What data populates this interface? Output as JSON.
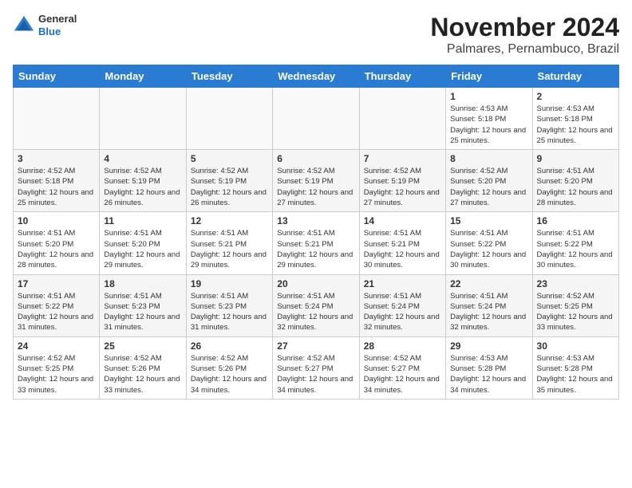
{
  "header": {
    "logo_general": "General",
    "logo_blue": "Blue",
    "month_title": "November 2024",
    "location": "Palmares, Pernambuco, Brazil"
  },
  "days_of_week": [
    "Sunday",
    "Monday",
    "Tuesday",
    "Wednesday",
    "Thursday",
    "Friday",
    "Saturday"
  ],
  "weeks": [
    [
      {
        "day": "",
        "info": ""
      },
      {
        "day": "",
        "info": ""
      },
      {
        "day": "",
        "info": ""
      },
      {
        "day": "",
        "info": ""
      },
      {
        "day": "",
        "info": ""
      },
      {
        "day": "1",
        "info": "Sunrise: 4:53 AM\nSunset: 5:18 PM\nDaylight: 12 hours and 25 minutes."
      },
      {
        "day": "2",
        "info": "Sunrise: 4:53 AM\nSunset: 5:18 PM\nDaylight: 12 hours and 25 minutes."
      }
    ],
    [
      {
        "day": "3",
        "info": "Sunrise: 4:52 AM\nSunset: 5:18 PM\nDaylight: 12 hours and 25 minutes."
      },
      {
        "day": "4",
        "info": "Sunrise: 4:52 AM\nSunset: 5:19 PM\nDaylight: 12 hours and 26 minutes."
      },
      {
        "day": "5",
        "info": "Sunrise: 4:52 AM\nSunset: 5:19 PM\nDaylight: 12 hours and 26 minutes."
      },
      {
        "day": "6",
        "info": "Sunrise: 4:52 AM\nSunset: 5:19 PM\nDaylight: 12 hours and 27 minutes."
      },
      {
        "day": "7",
        "info": "Sunrise: 4:52 AM\nSunset: 5:19 PM\nDaylight: 12 hours and 27 minutes."
      },
      {
        "day": "8",
        "info": "Sunrise: 4:52 AM\nSunset: 5:20 PM\nDaylight: 12 hours and 27 minutes."
      },
      {
        "day": "9",
        "info": "Sunrise: 4:51 AM\nSunset: 5:20 PM\nDaylight: 12 hours and 28 minutes."
      }
    ],
    [
      {
        "day": "10",
        "info": "Sunrise: 4:51 AM\nSunset: 5:20 PM\nDaylight: 12 hours and 28 minutes."
      },
      {
        "day": "11",
        "info": "Sunrise: 4:51 AM\nSunset: 5:20 PM\nDaylight: 12 hours and 29 minutes."
      },
      {
        "day": "12",
        "info": "Sunrise: 4:51 AM\nSunset: 5:21 PM\nDaylight: 12 hours and 29 minutes."
      },
      {
        "day": "13",
        "info": "Sunrise: 4:51 AM\nSunset: 5:21 PM\nDaylight: 12 hours and 29 minutes."
      },
      {
        "day": "14",
        "info": "Sunrise: 4:51 AM\nSunset: 5:21 PM\nDaylight: 12 hours and 30 minutes."
      },
      {
        "day": "15",
        "info": "Sunrise: 4:51 AM\nSunset: 5:22 PM\nDaylight: 12 hours and 30 minutes."
      },
      {
        "day": "16",
        "info": "Sunrise: 4:51 AM\nSunset: 5:22 PM\nDaylight: 12 hours and 30 minutes."
      }
    ],
    [
      {
        "day": "17",
        "info": "Sunrise: 4:51 AM\nSunset: 5:22 PM\nDaylight: 12 hours and 31 minutes."
      },
      {
        "day": "18",
        "info": "Sunrise: 4:51 AM\nSunset: 5:23 PM\nDaylight: 12 hours and 31 minutes."
      },
      {
        "day": "19",
        "info": "Sunrise: 4:51 AM\nSunset: 5:23 PM\nDaylight: 12 hours and 31 minutes."
      },
      {
        "day": "20",
        "info": "Sunrise: 4:51 AM\nSunset: 5:24 PM\nDaylight: 12 hours and 32 minutes."
      },
      {
        "day": "21",
        "info": "Sunrise: 4:51 AM\nSunset: 5:24 PM\nDaylight: 12 hours and 32 minutes."
      },
      {
        "day": "22",
        "info": "Sunrise: 4:51 AM\nSunset: 5:24 PM\nDaylight: 12 hours and 32 minutes."
      },
      {
        "day": "23",
        "info": "Sunrise: 4:52 AM\nSunset: 5:25 PM\nDaylight: 12 hours and 33 minutes."
      }
    ],
    [
      {
        "day": "24",
        "info": "Sunrise: 4:52 AM\nSunset: 5:25 PM\nDaylight: 12 hours and 33 minutes."
      },
      {
        "day": "25",
        "info": "Sunrise: 4:52 AM\nSunset: 5:26 PM\nDaylight: 12 hours and 33 minutes."
      },
      {
        "day": "26",
        "info": "Sunrise: 4:52 AM\nSunset: 5:26 PM\nDaylight: 12 hours and 34 minutes."
      },
      {
        "day": "27",
        "info": "Sunrise: 4:52 AM\nSunset: 5:27 PM\nDaylight: 12 hours and 34 minutes."
      },
      {
        "day": "28",
        "info": "Sunrise: 4:52 AM\nSunset: 5:27 PM\nDaylight: 12 hours and 34 minutes."
      },
      {
        "day": "29",
        "info": "Sunrise: 4:53 AM\nSunset: 5:28 PM\nDaylight: 12 hours and 34 minutes."
      },
      {
        "day": "30",
        "info": "Sunrise: 4:53 AM\nSunset: 5:28 PM\nDaylight: 12 hours and 35 minutes."
      }
    ]
  ]
}
